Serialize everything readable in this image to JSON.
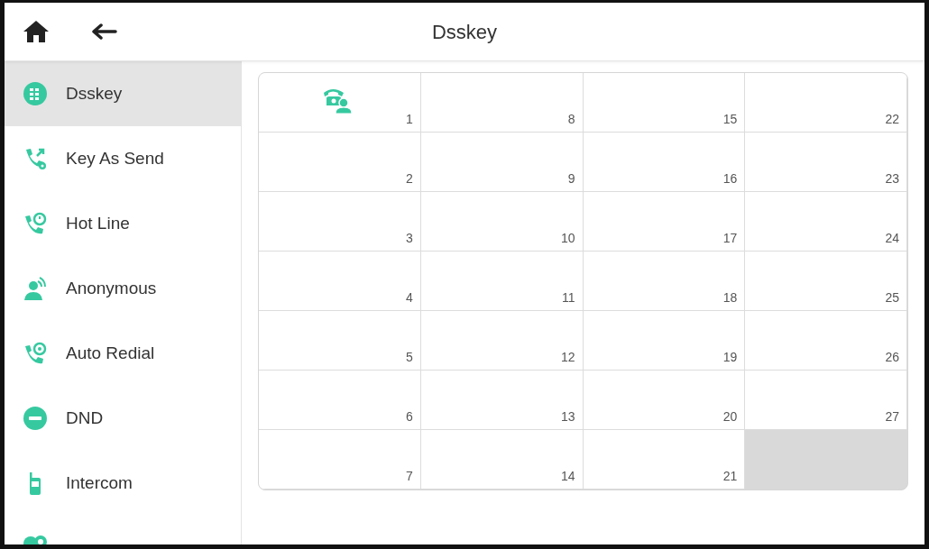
{
  "header": {
    "title": "Dsskey"
  },
  "sidebar": {
    "items": [
      {
        "label": "Dsskey",
        "selected": true
      },
      {
        "label": "Key As Send",
        "selected": false
      },
      {
        "label": "Hot Line",
        "selected": false
      },
      {
        "label": "Anonymous",
        "selected": false
      },
      {
        "label": "Auto Redial",
        "selected": false
      },
      {
        "label": "DND",
        "selected": false
      },
      {
        "label": "Intercom",
        "selected": false
      },
      {
        "selected": false
      }
    ]
  },
  "keys": [
    {
      "number": "1",
      "kind": "line"
    },
    {
      "number": "2"
    },
    {
      "number": "3"
    },
    {
      "number": "4"
    },
    {
      "number": "5"
    },
    {
      "number": "6"
    },
    {
      "number": "7"
    },
    {
      "number": "8"
    },
    {
      "number": "9"
    },
    {
      "number": "10"
    },
    {
      "number": "11"
    },
    {
      "number": "12"
    },
    {
      "number": "13"
    },
    {
      "number": "14"
    },
    {
      "number": "15"
    },
    {
      "number": "16"
    },
    {
      "number": "17"
    },
    {
      "number": "18"
    },
    {
      "number": "19"
    },
    {
      "number": "20"
    },
    {
      "number": "21"
    },
    {
      "number": "22"
    },
    {
      "number": "23"
    },
    {
      "number": "24"
    },
    {
      "number": "25"
    },
    {
      "number": "26"
    },
    {
      "number": "27"
    }
  ]
}
